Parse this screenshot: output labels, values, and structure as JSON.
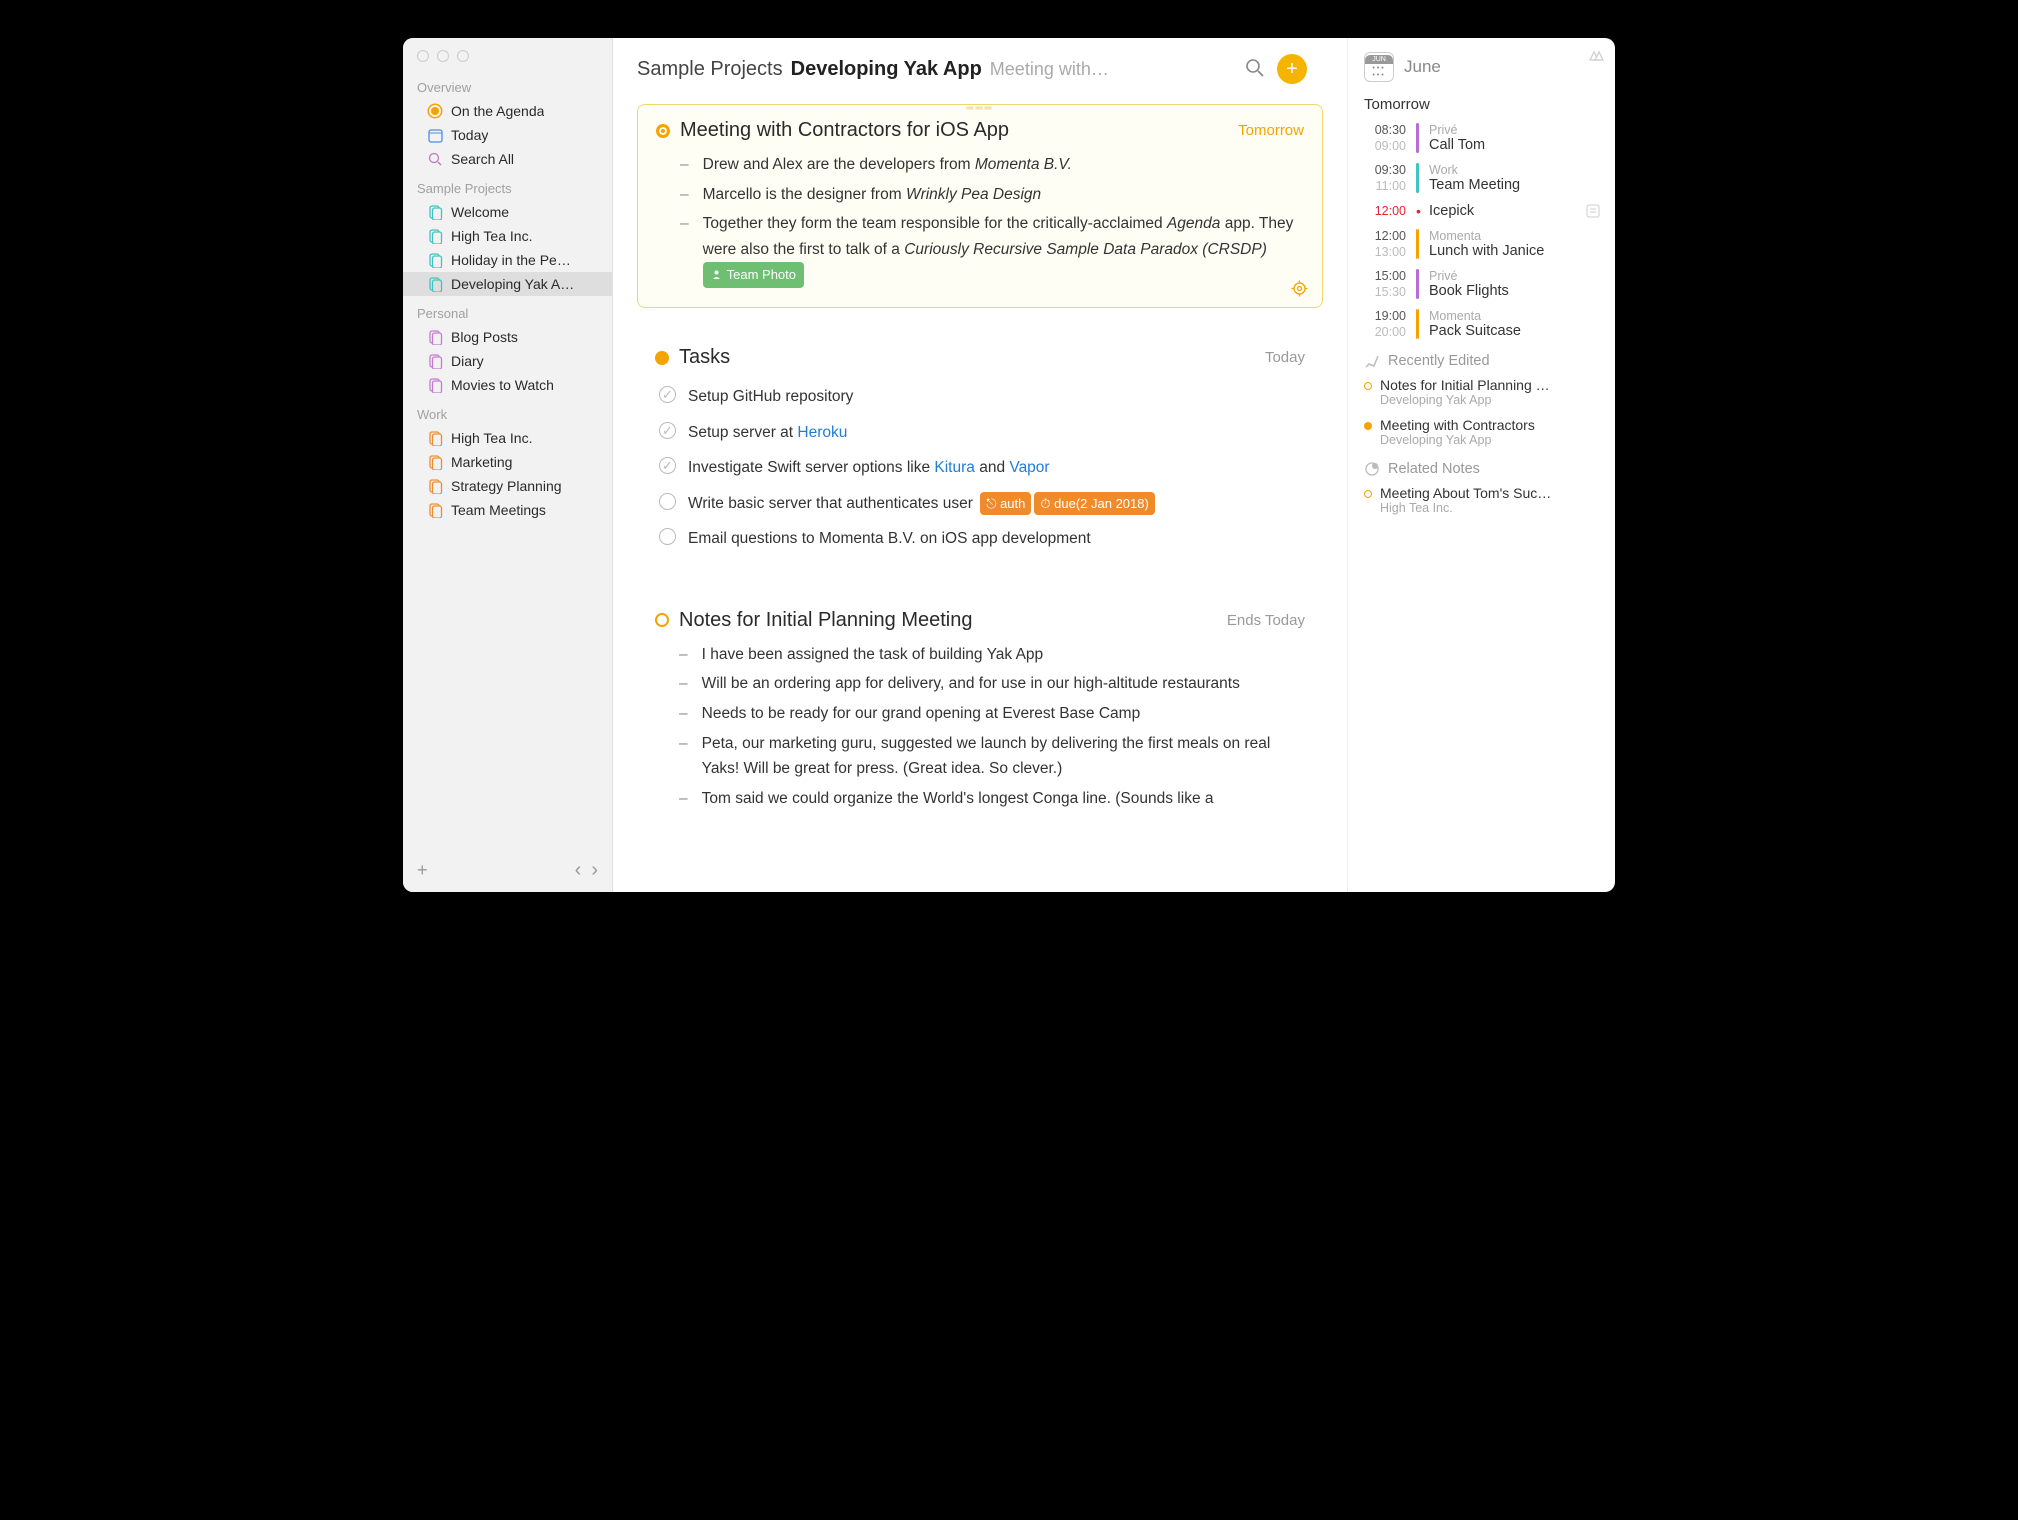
{
  "sidebar": {
    "groups": [
      {
        "title": "Overview",
        "items": [
          {
            "icon": "agenda-dot",
            "label": "On the Agenda"
          },
          {
            "icon": "today",
            "label": "Today"
          },
          {
            "icon": "search",
            "label": "Search All"
          }
        ]
      },
      {
        "title": "Sample Projects",
        "items": [
          {
            "icon": "doc-teal",
            "label": "Welcome"
          },
          {
            "icon": "doc-teal",
            "label": "High Tea Inc."
          },
          {
            "icon": "doc-teal",
            "label": "Holiday in the Pe…"
          },
          {
            "icon": "doc-teal",
            "label": "Developing Yak A…",
            "selected": true
          }
        ]
      },
      {
        "title": "Personal",
        "items": [
          {
            "icon": "doc-purple",
            "label": "Blog Posts"
          },
          {
            "icon": "doc-purple",
            "label": "Diary"
          },
          {
            "icon": "doc-purple",
            "label": "Movies to Watch"
          }
        ]
      },
      {
        "title": "Work",
        "items": [
          {
            "icon": "doc-orange",
            "label": "High Tea Inc."
          },
          {
            "icon": "doc-orange",
            "label": "Marketing"
          },
          {
            "icon": "doc-orange",
            "label": "Strategy Planning"
          },
          {
            "icon": "doc-orange",
            "label": "Team Meetings"
          }
        ]
      }
    ]
  },
  "breadcrumb": {
    "level1": "Sample Projects",
    "level2": "Developing Yak App",
    "level3": "Meeting with…"
  },
  "notes": {
    "n0": {
      "title": "Meeting with Contractors for iOS App",
      "date": "Tomorrow",
      "b0_pre": "Drew and Alex are the developers from ",
      "b0_em": "Momenta B.V.",
      "b1_pre": "Marcello is the designer from ",
      "b1_em": "Wrinkly Pea Design",
      "b2_pre": "Together they form the team responsible for the critically-acclaimed ",
      "b2_em1": "Agenda",
      "b2_mid": " app. They were also the first to talk of a ",
      "b2_em2": "Curiously Recursive Sample Data Paradox (CRSDP)",
      "chip": "Team Photo"
    },
    "n1": {
      "title": "Tasks",
      "date": "Today",
      "t0": "Setup GitHub repository",
      "t1_pre": "Setup server at ",
      "t1_link": "Heroku",
      "t2_pre": "Investigate Swift server options like ",
      "t2_l1": "Kitura",
      "t2_mid": " and ",
      "t2_l2": "Vapor",
      "t3_pre": "Write basic server that authenticates user ",
      "t3_tag1": "⎋ auth",
      "t3_tag2": "⏱ due(2 Jan 2018)",
      "t4": "Email questions to Momenta B.V. on iOS app development"
    },
    "n2": {
      "title": "Notes for Initial Planning Meeting",
      "date": "Ends Today",
      "b0": "I have been assigned the task of building Yak App",
      "b1": "Will be an ordering app for delivery, and for use in our high-altitude restaurants",
      "b2": "Needs to be ready for our grand opening at Everest Base Camp",
      "b3": "Peta, our marketing guru, suggested we launch by delivering the first meals on real Yaks! Will be great for press. (Great idea. So clever.)",
      "b4": "Tom said we could organize the World's longest Conga line. (Sounds like a"
    }
  },
  "right": {
    "month": "June",
    "cal_top": "JUN",
    "dayLabel": "Tomorrow",
    "events": [
      {
        "t1": "08:30",
        "t2": "09:00",
        "bar": "purple",
        "cat": "Privé",
        "title": "Call Tom"
      },
      {
        "t1": "09:30",
        "t2": "11:00",
        "bar": "teal",
        "cat": "Work",
        "title": "Team Meeting"
      },
      {
        "t1": "12:00",
        "t2": "",
        "bar": "dot",
        "cat": "",
        "title": "Icepick",
        "red": true,
        "noteicon": true
      },
      {
        "t1": "12:00",
        "t2": "13:00",
        "bar": "orange",
        "cat": "Momenta",
        "title": "Lunch with Janice"
      },
      {
        "t1": "15:00",
        "t2": "15:30",
        "bar": "purple",
        "cat": "Privé",
        "title": "Book Flights"
      },
      {
        "t1": "19:00",
        "t2": "20:00",
        "bar": "orange",
        "cat": "Momenta",
        "title": "Pack Suitcase"
      }
    ],
    "recent_title": "Recently Edited",
    "recent": [
      {
        "dot": "ring",
        "title": "Notes for Initial Planning …",
        "sub": "Developing Yak App"
      },
      {
        "dot": "solid",
        "title": "Meeting with Contractors",
        "sub": "Developing Yak App"
      }
    ],
    "related_title": "Related Notes",
    "related": [
      {
        "dot": "ring",
        "title": "Meeting About Tom's Suc…",
        "sub": "High Tea Inc."
      }
    ]
  },
  "icons": {
    "plus": "+",
    "chev_l": "‹",
    "chev_r": "›"
  }
}
